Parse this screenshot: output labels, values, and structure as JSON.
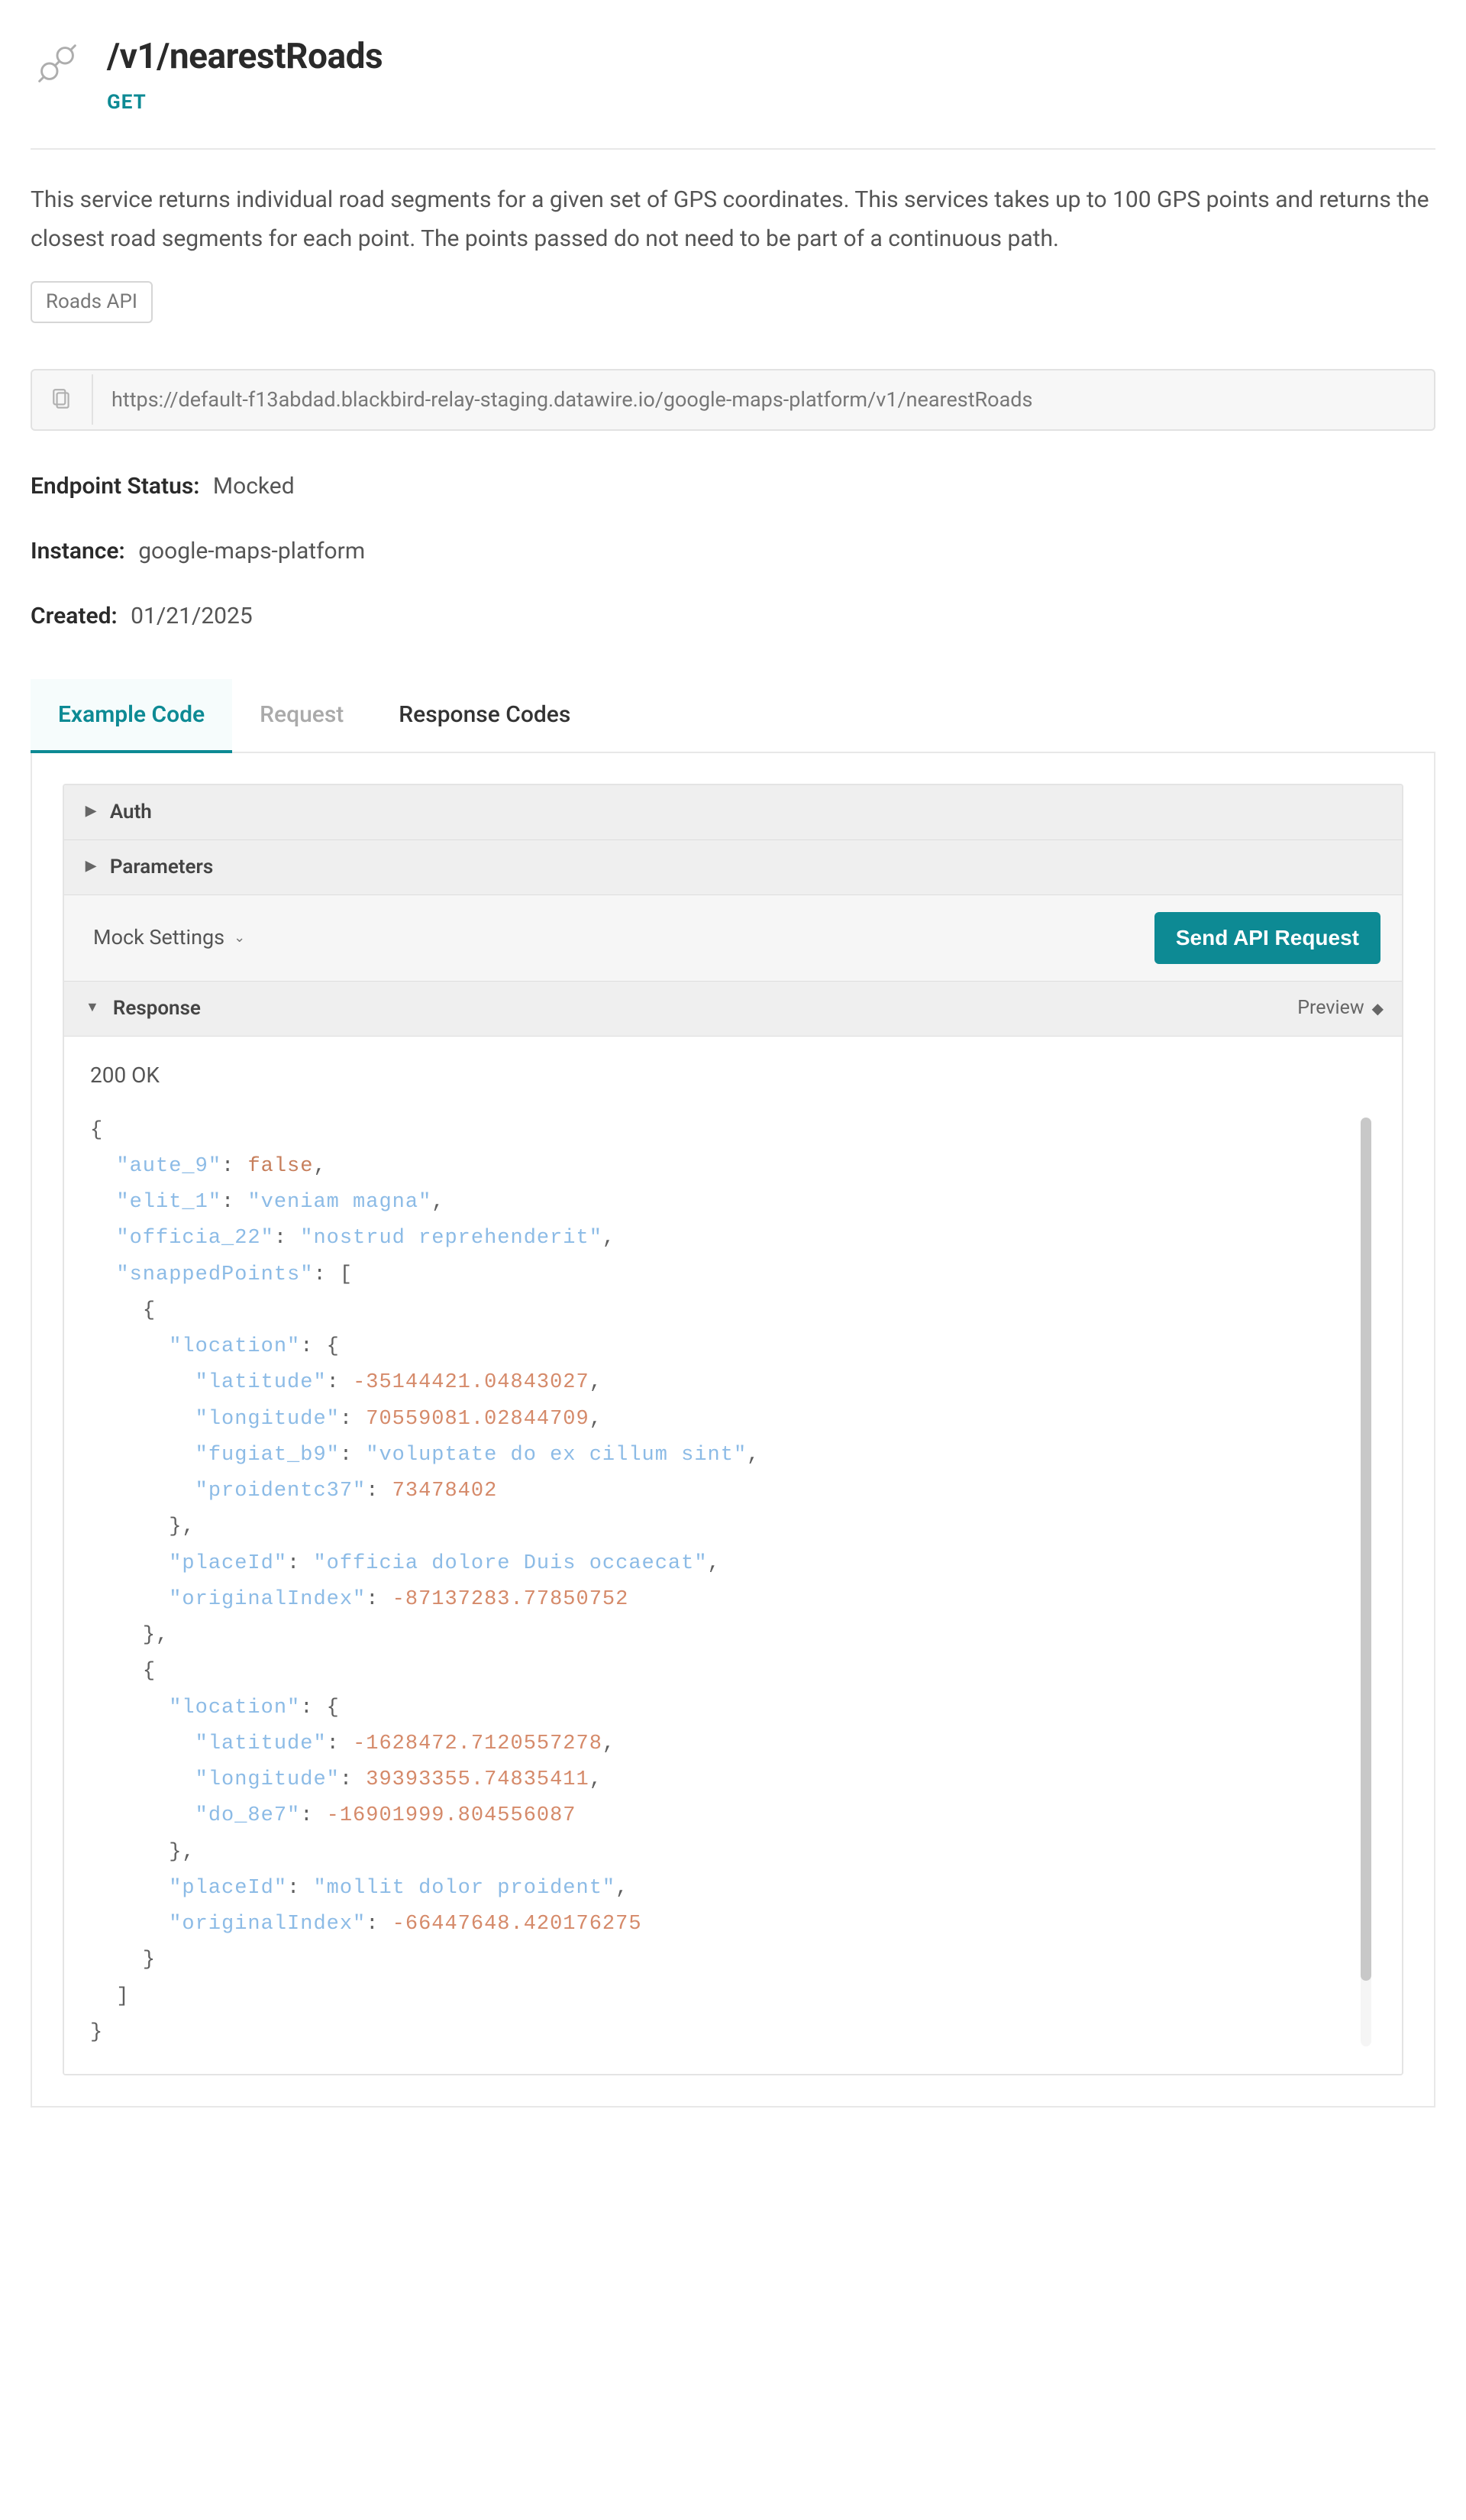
{
  "header": {
    "title": "/v1/nearestRoads",
    "method": "GET"
  },
  "description": "This service returns individual road segments for a given set of GPS coordinates. This services takes up to 100 GPS points and returns the closest road segments for each point. The points passed do not need to be part of a continuous path.",
  "tag": "Roads API",
  "url": "https://default-f13abdad.blackbird-relay-staging.datawire.io/google-maps-platform/v1/nearestRoads",
  "meta": {
    "endpoint_status_label": "Endpoint Status:",
    "endpoint_status_value": "Mocked",
    "instance_label": "Instance:",
    "instance_value": "google-maps-platform",
    "created_label": "Created:",
    "created_value": "01/21/2025"
  },
  "tabs": {
    "example_code": "Example Code",
    "request": "Request",
    "response_codes": "Response Codes"
  },
  "accordion": {
    "auth": "Auth",
    "parameters": "Parameters",
    "mock_settings": "Mock Settings",
    "response": "Response",
    "preview": "Preview"
  },
  "buttons": {
    "send": "Send API Request"
  },
  "response": {
    "status": "200 OK",
    "body": {
      "aute_9": false,
      "elit_1": "veniam magna",
      "officia_22": "nostrud reprehenderit",
      "snappedPoints": [
        {
          "location": {
            "latitude": -35144421.04843027,
            "longitude": 70559081.02844709,
            "fugiat_b9": "voluptate do ex cillum sint",
            "proidentc37": 73478402
          },
          "placeId": "officia dolore Duis occaecat",
          "originalIndex": -87137283.77850752
        },
        {
          "location": {
            "latitude": -1628472.7120557278,
            "longitude": 39393355.74835411,
            "do_8e7": -16901999.804556087
          },
          "placeId": "mollit dolor proident",
          "originalIndex": -66447648.420176275
        }
      ]
    }
  }
}
